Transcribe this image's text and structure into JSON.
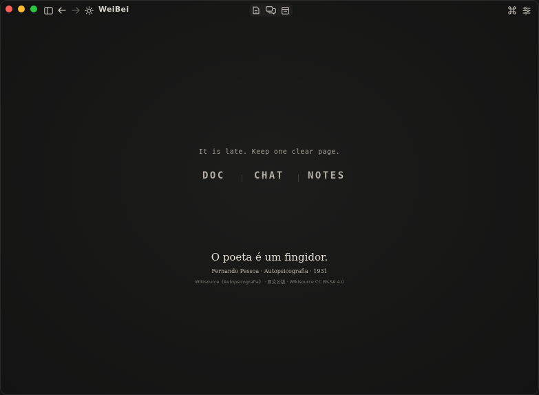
{
  "window": {
    "app_title": "WeiBei"
  },
  "toolbar": {
    "left_icons": [
      "sidebar-toggle-icon",
      "back-arrow-icon",
      "forward-arrow-icon",
      "sun-icon"
    ],
    "center_icons": [
      "document-icon",
      "chat-bubbles-icon",
      "notes-panel-icon"
    ],
    "right_icons": [
      "command-key-icon",
      "sliders-icon"
    ]
  },
  "main": {
    "tagline": "It is late. Keep one clear page.",
    "modes": {
      "doc": "DOC",
      "chat": "CHAT",
      "notes": "NOTES"
    },
    "quote": {
      "text": "O poeta é um fingidor.",
      "attribution": "Fernando Pessoa · Autopsicografia · 1931",
      "source": "Wikisource《Autopsicografia》 · 原文公版 · Wikisource CC BY-SA 4.0"
    }
  },
  "colors": {
    "background": "#161616",
    "text_primary": "#e6e1d6",
    "text_muted": "#a8a398",
    "close": "#fe5f57",
    "minimize": "#febc2e",
    "zoom": "#28c840"
  }
}
